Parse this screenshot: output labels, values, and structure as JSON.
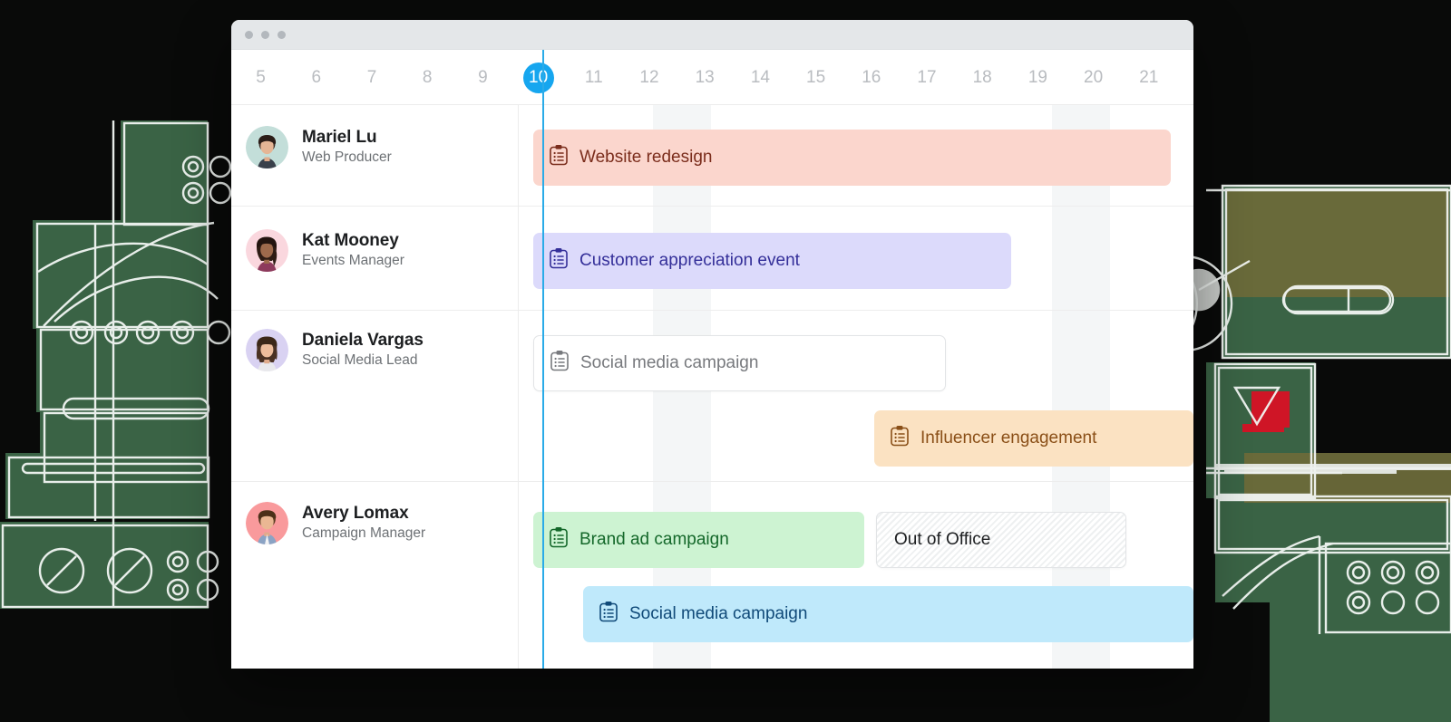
{
  "window": {
    "titlebar_dots": [
      "dot",
      "dot",
      "dot"
    ]
  },
  "timeline": {
    "days": [
      "5",
      "6",
      "7",
      "8",
      "9",
      "10",
      "11",
      "12",
      "13",
      "14",
      "15",
      "16",
      "17",
      "18",
      "19",
      "20",
      "21"
    ],
    "today": "10",
    "today_color": "#16a6ef",
    "weekend_shade_color": "#f4f6f7"
  },
  "people": [
    {
      "name": "Mariel Lu",
      "role": "Web Producer",
      "avatar_bg": "#c3ded9",
      "avatar_id": "avatar-mariel-lu"
    },
    {
      "name": "Kat Mooney",
      "role": "Events Manager",
      "avatar_bg": "#fad7de",
      "avatar_id": "avatar-kat-mooney"
    },
    {
      "name": "Daniela Vargas",
      "role": "Social Media Lead",
      "avatar_bg": "#d9d2f2",
      "avatar_id": "avatar-daniela-vargas"
    },
    {
      "name": "Avery Lomax",
      "role": "Campaign Manager",
      "avatar_bg": "#f99a9c",
      "avatar_id": "avatar-avery-lomax"
    }
  ],
  "tasks": [
    {
      "label": "Website redesign",
      "color": "red",
      "icon": "clipboard-task-icon",
      "bg": "#fbd6cd",
      "text": "#7b2d1c"
    },
    {
      "label": "Customer appreciation event",
      "color": "purple",
      "icon": "clipboard-task-icon",
      "bg": "#dcdafb",
      "text": "#342f99"
    },
    {
      "label": "Social media campaign",
      "color": "white",
      "icon": "clipboard-task-icon",
      "bg": "#ffffff",
      "text": "#77797d"
    },
    {
      "label": "Influencer engagement",
      "color": "orange",
      "icon": "clipboard-task-icon",
      "bg": "#fbe2c2",
      "text": "#8a4f17"
    },
    {
      "label": "Brand ad campaign",
      "color": "green",
      "icon": "clipboard-task-icon",
      "bg": "#cdf3d2",
      "text": "#14682a"
    },
    {
      "label": "Out of Office",
      "color": "ooo",
      "icon": "none",
      "bg": "#ffffff",
      "text": "#1d1f21"
    },
    {
      "label": "Social media campaign",
      "color": "blue",
      "icon": "clipboard-task-icon",
      "bg": "#bfe9fb",
      "text": "#104a79"
    }
  ]
}
